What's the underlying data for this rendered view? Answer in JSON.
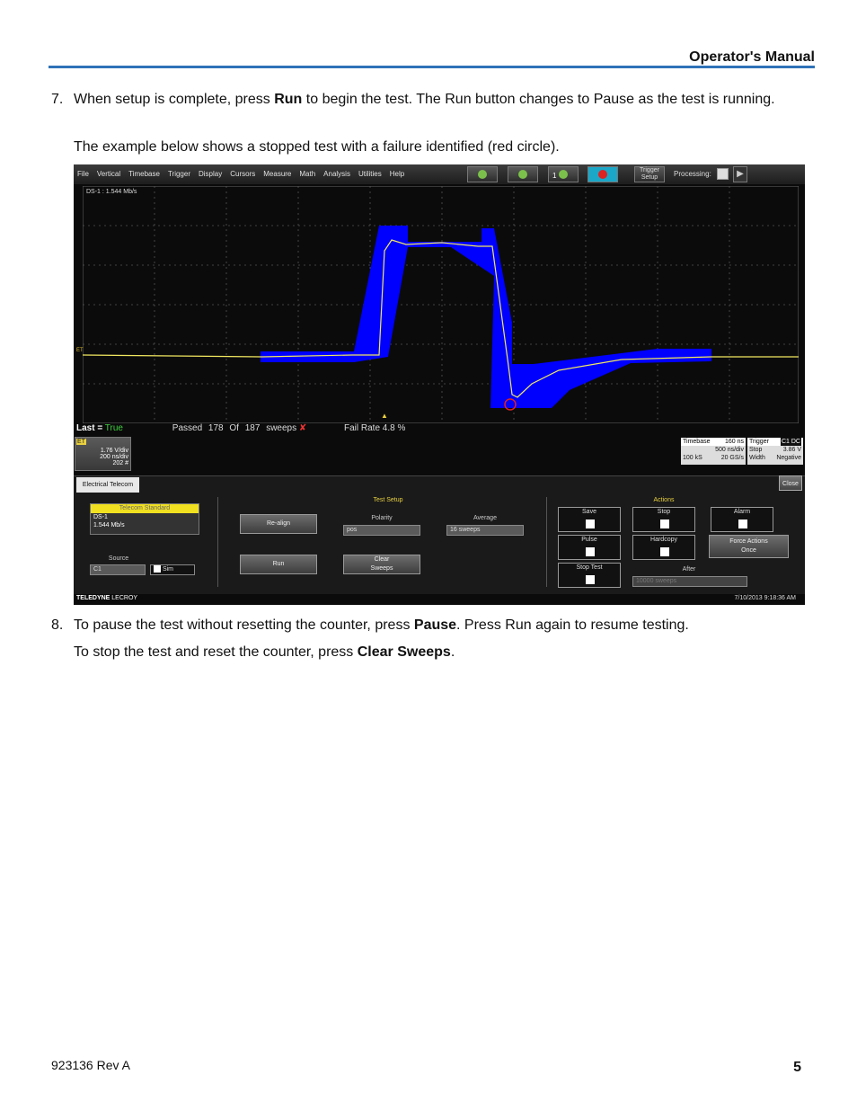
{
  "header": {
    "title": "Operator's Manual"
  },
  "step7": {
    "number": "7.",
    "pre": "When setup is complete, press ",
    "bold": "Run",
    "post": " to begin the test. The Run button changes to Pause as the test is running.",
    "note": "The example below shows a stopped test with a failure identified (red circle)."
  },
  "step8": {
    "number": "8.",
    "pre": "To pause the test without resetting the counter, press ",
    "bold": "Pause",
    "post": ". Press Run again to resume testing.",
    "note_pre": "To stop the test and reset the counter, press ",
    "note_bold": "Clear Sweeps",
    "note_post": "."
  },
  "scope": {
    "menu": [
      "File",
      "Vertical",
      "Timebase",
      "Trigger",
      "Display",
      "Cursors",
      "Measure",
      "Math",
      "Analysis",
      "Utilities",
      "Help"
    ],
    "trigger_setup": [
      "Trigger",
      "Setup"
    ],
    "processing": "Processing:",
    "toolbar_badge": "1",
    "ds_label": "DS-1  :  1.544 Mb/s",
    "et_mark": "ET",
    "stats": {
      "last_label": "Last =",
      "last_value": "True",
      "passed_label": "Passed",
      "passed": "178",
      "of_label": "Of",
      "total": "187",
      "sweeps_label": "sweeps",
      "fail_label": "Fail Rate",
      "fail_rate": "4.8 %"
    },
    "channel": {
      "tag": "ET",
      "vdiv": "1.76 V/div",
      "nsdiv": "200 ns/div",
      "count": "202 #"
    },
    "timebase": {
      "title": "Timebase",
      "delay": "160 ns",
      "rate1": "500 ns/div",
      "samples": "100 kS",
      "rate2": "20 GS/s"
    },
    "trigger": {
      "title": "Trigger",
      "badge": "C1 DC",
      "mode": "Stop",
      "level": "3.86 V",
      "type": "Width",
      "slope": "Negative"
    },
    "panel": {
      "tab": "Electrical Telecom",
      "close": "Close",
      "telecom_standard": "Telecom Standard",
      "std_line1": "DS-1",
      "std_line2": "1.544 Mb/s",
      "source_label": "Source",
      "source_value": "C1",
      "sim": "Sim",
      "test_setup": "Test Setup",
      "realign": "Re-align",
      "run": "Run",
      "polarity_label": "Polarity",
      "polarity_value": "pos",
      "average_label": "Average",
      "average_value": "16 sweeps",
      "clear": "Clear",
      "sweeps": "Sweeps",
      "save": "Save",
      "pulse": "Pulse",
      "stop_test": "Stop Test",
      "actions": "Actions",
      "stop": "Stop",
      "alarm": "Alarm",
      "hardcopy": "Hardcopy",
      "force_actions": "Force Actions",
      "once": "Once",
      "after": "After",
      "after_value": "10000 sweeps"
    },
    "brand": "TELEDYNE",
    "brand2": " LECROY",
    "timestamp": "7/10/2013 9:18:36 AM",
    "colors": {
      "mask": "#0000ff",
      "trace": "#e8d040",
      "fail": "#e02020",
      "accent": "#2f72b8"
    }
  },
  "footer": {
    "doc": "923136 Rev A",
    "page": "5"
  }
}
